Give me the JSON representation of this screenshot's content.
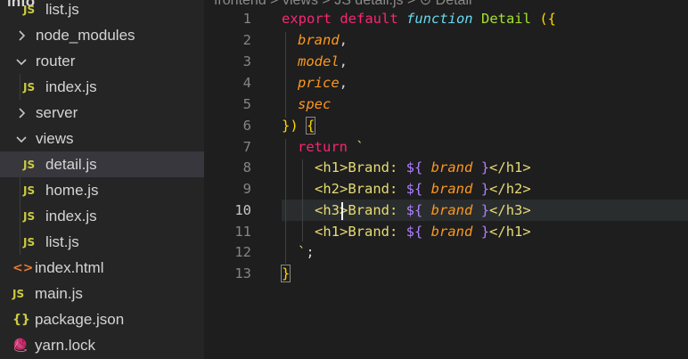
{
  "explorer": {
    "header_clip": "info",
    "items": [
      {
        "label": "list.js",
        "type": "js"
      },
      {
        "label": "node_modules",
        "type": "folder-collapsed"
      },
      {
        "label": "router",
        "type": "folder-expanded"
      },
      {
        "label": "index.js",
        "type": "js"
      },
      {
        "label": "server",
        "type": "folder-collapsed"
      },
      {
        "label": "views",
        "type": "folder-expanded"
      },
      {
        "label": "detail.js",
        "type": "js",
        "active": true
      },
      {
        "label": "home.js",
        "type": "js"
      },
      {
        "label": "index.js",
        "type": "js"
      },
      {
        "label": "list.js",
        "type": "js"
      },
      {
        "label": "index.html",
        "type": "html"
      },
      {
        "label": "main.js",
        "type": "js"
      },
      {
        "label": "package.json",
        "type": "json"
      },
      {
        "label": "yarn.lock",
        "type": "yarn"
      }
    ],
    "icons": {
      "js": "JS",
      "html": "<>",
      "json": "{}",
      "yarn": "🧶"
    }
  },
  "breadcrumb": {
    "text": "frontend > views > JS detail.js > ⊙ Detail"
  },
  "editor": {
    "active_line": 10,
    "line_numbers": [
      "1",
      "2",
      "3",
      "4",
      "5",
      "6",
      "7",
      "8",
      "9",
      "10",
      "11",
      "12",
      "13"
    ],
    "lines": {
      "l1": {
        "kw1": "export default ",
        "kw2": "function",
        "sp": " ",
        "fn": "Detail",
        "sp2": " ",
        "open": "({"
      },
      "l2": {
        "param": "brand",
        "punc": ","
      },
      "l3": {
        "param": "model",
        "punc": ","
      },
      "l4": {
        "param": "price",
        "punc": ","
      },
      "l5": {
        "param": "spec"
      },
      "l6": {
        "close": "})",
        "sp": " ",
        "open": "{"
      },
      "l7": {
        "kw": "return",
        "tick": " `"
      },
      "l8": {
        "tag": "<h1>Brand: ",
        "i1": "${",
        "sp1": " ",
        "param": "brand",
        "sp2": " ",
        "i2": "}",
        "tagc": "</h1>"
      },
      "l9": {
        "tag": "<h2>Brand: ",
        "i1": "${",
        "sp1": " ",
        "param": "brand",
        "sp2": " ",
        "i2": "}",
        "tagc": "</h2>"
      },
      "l10": {
        "tag_a": "<h3",
        "tag_b": ">Brand: ",
        "i1": "${",
        "sp1": " ",
        "param": "brand",
        "sp2": " ",
        "i2": "}",
        "tagc": "</h3>"
      },
      "l11": {
        "tag": "<h1>Brand: ",
        "i1": "${",
        "sp1": " ",
        "param": "brand",
        "sp2": " ",
        "i2": "}",
        "tagc": "</h1>"
      },
      "l12": {
        "tick": "`",
        "punc": ";"
      },
      "l13": {
        "close": "}"
      }
    }
  }
}
